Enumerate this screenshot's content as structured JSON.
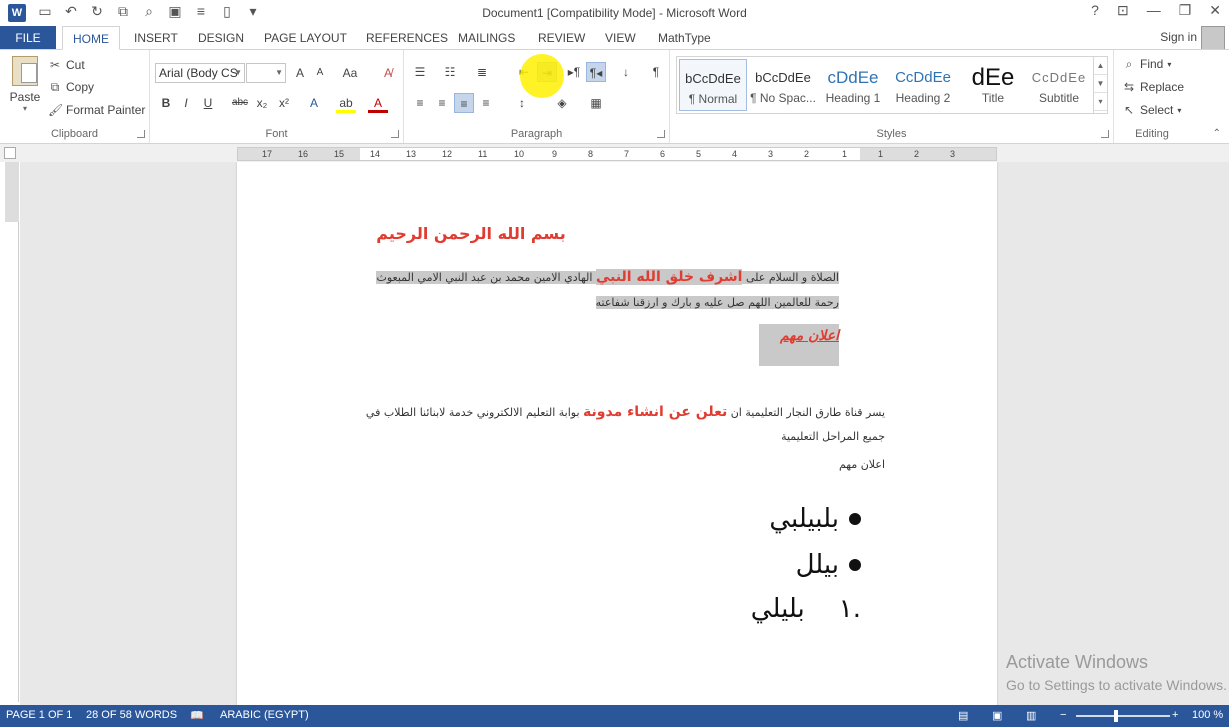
{
  "app": {
    "window_title": "Document1 [Compatibility Mode] - Microsoft Word",
    "help": "?",
    "sign_in": "Sign in"
  },
  "tabs": [
    "FILE",
    "HOME",
    "INSERT",
    "DESIGN",
    "PAGE LAYOUT",
    "REFERENCES",
    "MAILINGS",
    "REVIEW",
    "VIEW",
    "MathType"
  ],
  "clipboard": {
    "paste": "Paste",
    "cut": "Cut",
    "copy": "Copy",
    "format_painter": "Format Painter",
    "label": "Clipboard"
  },
  "font": {
    "font_name": "Arial (Body CS",
    "font_size": "",
    "label": "Font",
    "grow": "A",
    "shrink": "A",
    "case": "Aa",
    "bold": "B",
    "italic": "I",
    "underline": "U",
    "strike": "abc",
    "subscript": "x₂",
    "superscript": "x²"
  },
  "paragraph": {
    "label": "Paragraph",
    "pilcrow": "¶"
  },
  "styles": {
    "label": "Styles",
    "items": [
      {
        "sample": "bCcDdEe",
        "name": "¶ Normal"
      },
      {
        "sample": "bCcDdEe",
        "name": "¶ No Spac..."
      },
      {
        "sample": "cDdEe",
        "name": "Heading 1"
      },
      {
        "sample": "CcDdEe",
        "name": "Heading 2"
      },
      {
        "sample": "dEe",
        "name": "Title"
      },
      {
        "sample": "CcDdEe",
        "name": "Subtitle"
      }
    ]
  },
  "editing": {
    "find": "Find",
    "replace": "Replace",
    "select": "Select",
    "label": "Editing"
  },
  "ruler": {
    "ticks": [
      "17",
      "16",
      "15",
      "14",
      "13",
      "12",
      "11",
      "10",
      "9",
      "8",
      "7",
      "6",
      "5",
      "4",
      "3",
      "2",
      "1",
      "1",
      "2",
      "3"
    ]
  },
  "document": {
    "basmala": "بسم الله الرحمن الرحيم",
    "p1_before": "الصلاة و السلام على ",
    "p1_bold": "اشرف خلق الله النبي",
    "p1_after": " الهادي الامين محمد بن عبد النبي الامي المبعوث رحمة للعالمين اللهم صل عليه و بارك و ارزقنا شفاعته",
    "heading_ilan": "اعلان مهم",
    "p2_before": "يسر قناة طارق النجار التعليمية ان ",
    "p2_bold": "تعلن عن انشاء مدونة",
    "p2_after": " بوابة التعليم الالكتروني خدمة لابنائنا الطلاب في جميع المراحل التعليمية",
    "p3": "اعلان مهم",
    "bullets": [
      "بلبيلبي",
      "بيلل"
    ],
    "numbered": {
      "number": ".١",
      "text": "بليلي"
    }
  },
  "watermark": {
    "line1": "Activate Windows",
    "line2": "Go to Settings to activate Windows."
  },
  "status": {
    "page": "PAGE 1 OF 1",
    "words": "28 OF 58 WORDS",
    "language": "ARABIC (EGYPT)",
    "zoom": "100 %"
  }
}
